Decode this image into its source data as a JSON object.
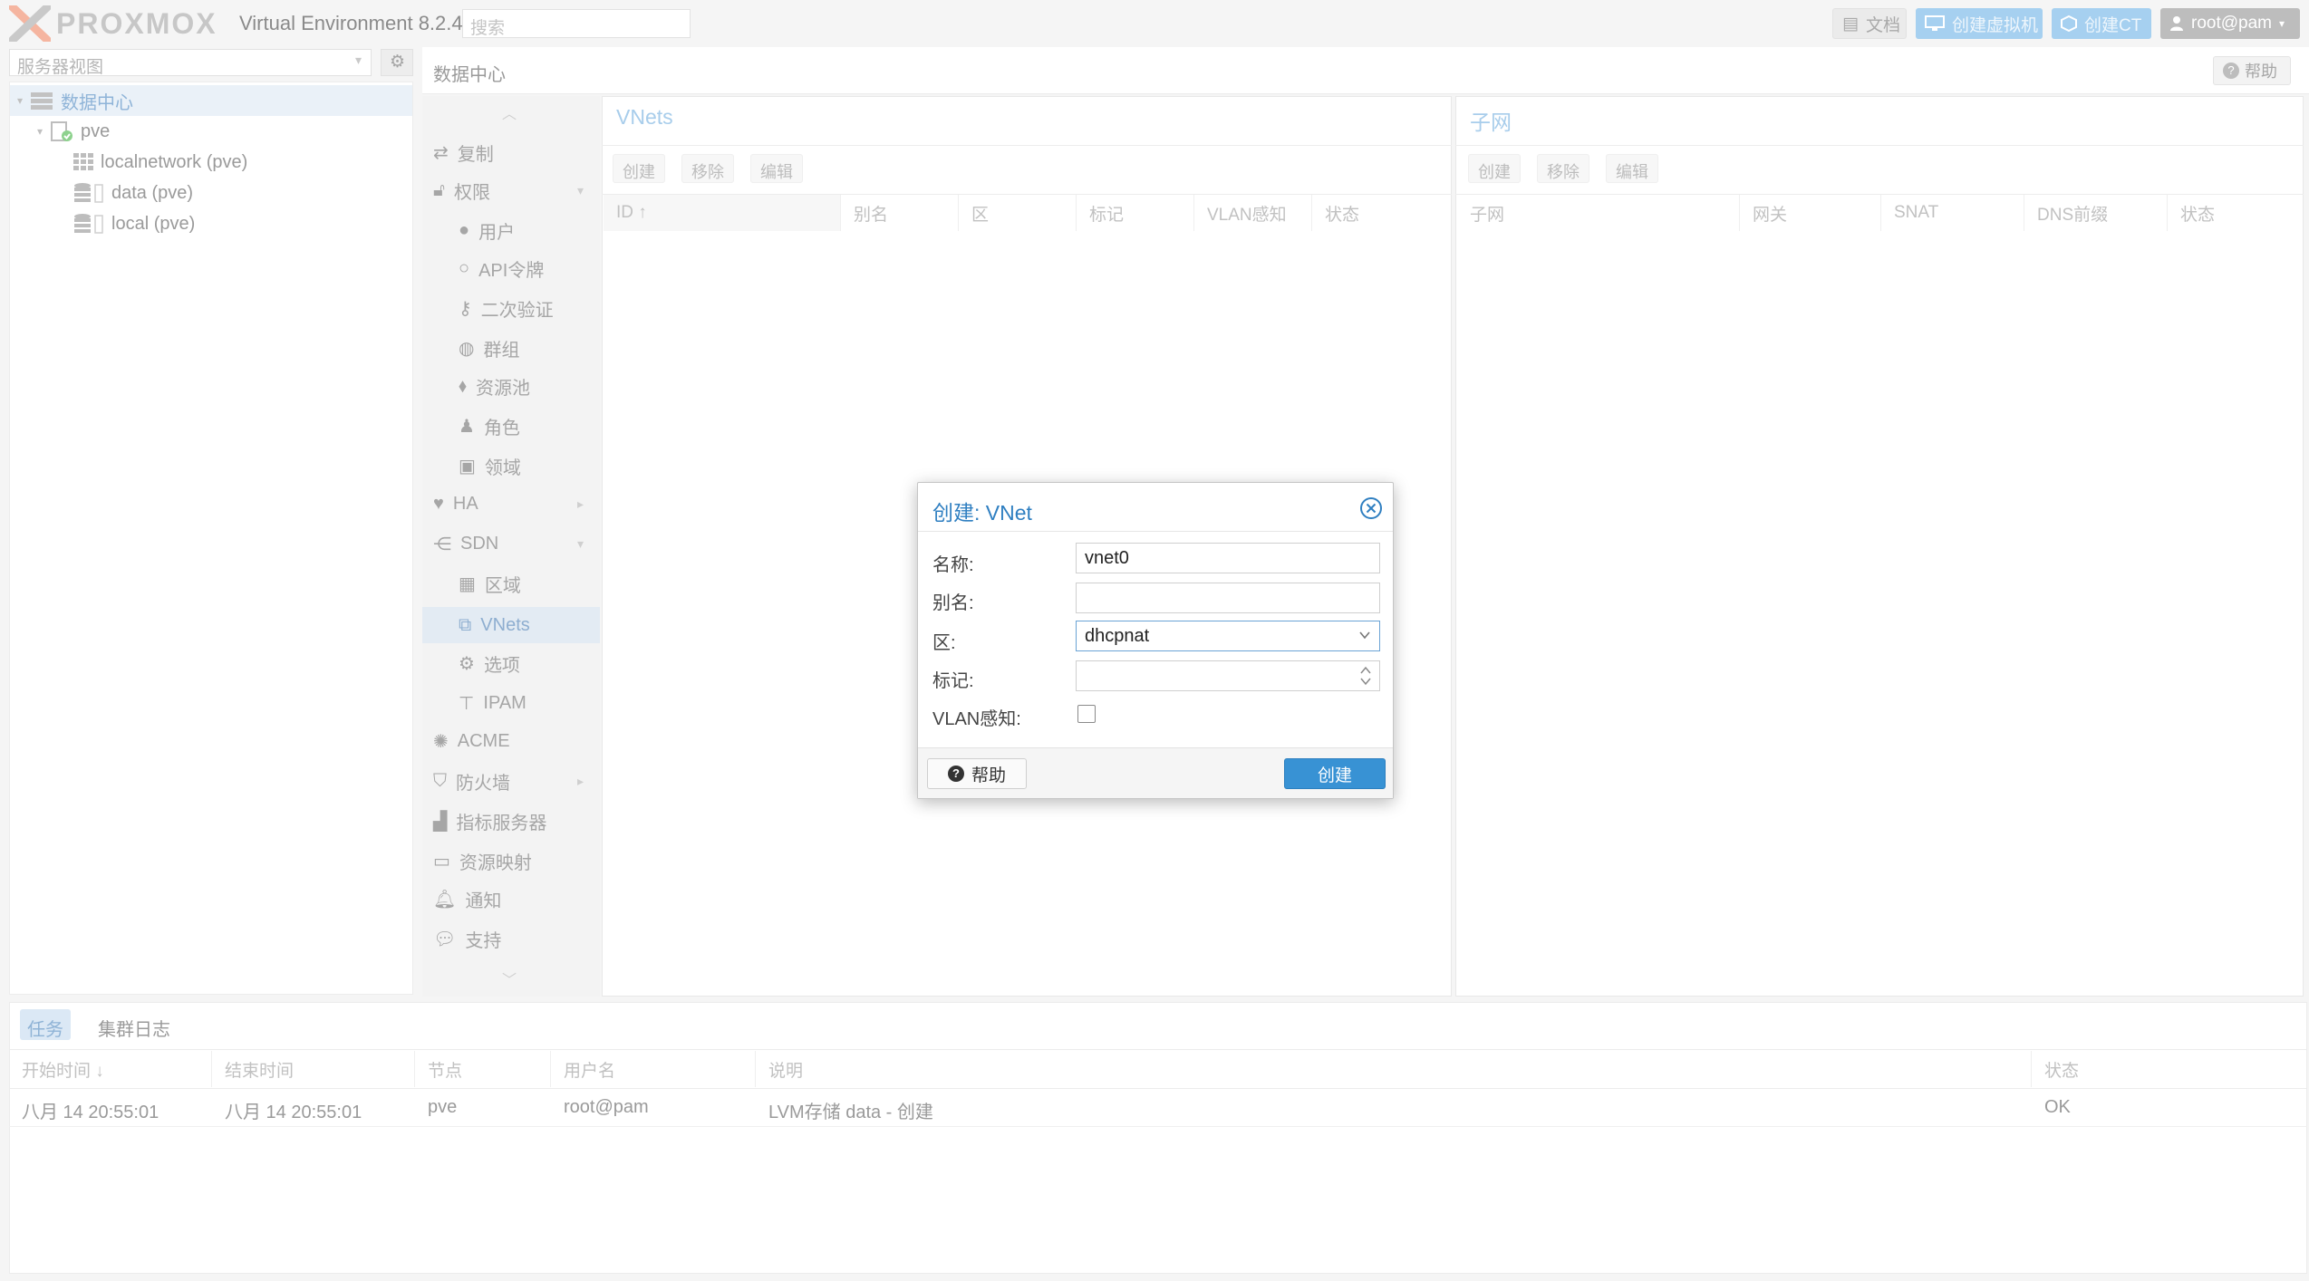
{
  "header": {
    "logo_text": "PROXMOX",
    "product": "Virtual Environment 8.2.4",
    "search_placeholder": "搜索",
    "docs": "文档",
    "create_vm": "创建虚拟机",
    "create_ct": "创建CT",
    "user": "root@pam"
  },
  "sidebar": {
    "view_select": "服务器视图",
    "tree": {
      "datacenter": "数据中心",
      "node": "pve",
      "children": [
        "localnetwork (pve)",
        "data (pve)",
        "local (pve)"
      ]
    }
  },
  "content": {
    "title": "数据中心",
    "help": "帮助"
  },
  "nav": {
    "items": [
      "复制",
      "权限",
      "用户",
      "API令牌",
      "二次验证",
      "群组",
      "资源池",
      "角色",
      "领域",
      "HA",
      "SDN",
      "区域",
      "VNets",
      "选项",
      "IPAM",
      "ACME",
      "防火墙",
      "指标服务器",
      "资源映射",
      "通知",
      "支持"
    ]
  },
  "vnets": {
    "title": "VNets",
    "buttons": [
      "创建",
      "移除",
      "编辑"
    ],
    "columns": [
      "ID ↑",
      "别名",
      "区",
      "标记",
      "VLAN感知",
      "状态"
    ]
  },
  "subnets": {
    "title": "子网",
    "buttons": [
      "创建",
      "移除",
      "编辑"
    ],
    "columns": [
      "子网",
      "网关",
      "SNAT",
      "DNS前缀",
      "状态"
    ]
  },
  "bottom": {
    "tabs": [
      "任务",
      "集群日志"
    ],
    "columns": [
      "开始时间 ↓",
      "结束时间",
      "节点",
      "用户名",
      "说明",
      "状态"
    ],
    "rows": [
      {
        "start": "八月 14 20:55:01",
        "end": "八月 14 20:55:01",
        "node": "pve",
        "user": "root@pam",
        "desc": "LVM存储 data - 创建",
        "status": "OK"
      }
    ]
  },
  "dialog": {
    "title": "创建: VNet",
    "labels": {
      "name": "名称:",
      "alias": "别名:",
      "zone": "区:",
      "tag": "标记:",
      "vlan": "VLAN感知:"
    },
    "values": {
      "name": "vnet0",
      "alias": "",
      "zone": "dhcpnat",
      "tag": "",
      "vlan_aware": false
    },
    "help": "帮助",
    "create": "创建"
  },
  "colors": {
    "accent": "#3892d4",
    "dialog_title": "#2f7fc1",
    "logo_orange": "#e57000"
  }
}
